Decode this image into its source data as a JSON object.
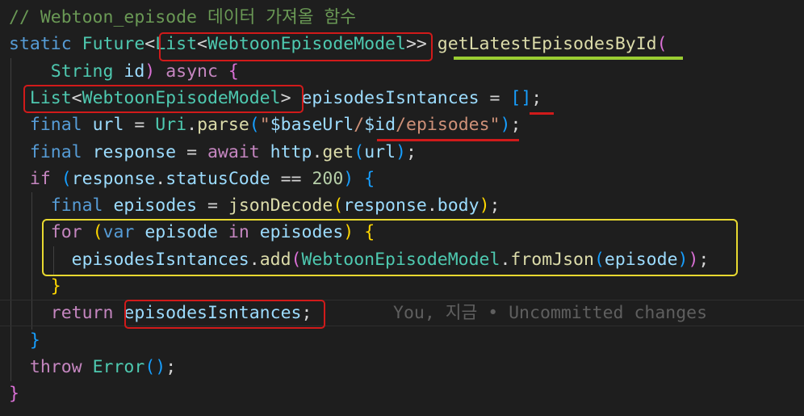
{
  "colors": {
    "background": "#1e1e1e",
    "comment": "#6a9955",
    "keyword": "#569cd6",
    "control": "#c586c0",
    "type": "#4ec9b0",
    "function": "#dcdcaa",
    "variable": "#9cdcfe",
    "string": "#ce9178",
    "number": "#b5cea8",
    "text": "#d4d4d4",
    "bracket_gold": "#ffd700",
    "bracket_purple": "#da70d6",
    "bracket_blue": "#179fff",
    "annotation_red": "#d11a1a",
    "annotation_yellow": "#e8d930",
    "annotation_green": "#9acd32"
  },
  "lines": [
    [
      {
        "t": "// Webtoon_episode 데이터 가져올 함수",
        "c": "comment"
      }
    ],
    [
      {
        "t": "static",
        "c": "keyword"
      },
      {
        "t": " "
      },
      {
        "t": "Future",
        "c": "type"
      },
      {
        "t": "<",
        "c": "text"
      },
      {
        "t": "List",
        "c": "type"
      },
      {
        "t": "<",
        "c": "text"
      },
      {
        "t": "WebtoonEpisodeModel",
        "c": "type"
      },
      {
        "t": ">>",
        "c": "text"
      },
      {
        "t": " "
      },
      {
        "t": "getLatestEpisodesById",
        "c": "function"
      },
      {
        "t": "(",
        "c": "bracket_purple"
      }
    ],
    [
      {
        "t": "    "
      },
      {
        "t": "String",
        "c": "type"
      },
      {
        "t": " "
      },
      {
        "t": "id",
        "c": "variable"
      },
      {
        "t": ")",
        "c": "bracket_purple"
      },
      {
        "t": " "
      },
      {
        "t": "async",
        "c": "control"
      },
      {
        "t": " "
      },
      {
        "t": "{",
        "c": "bracket_purple"
      }
    ],
    [
      {
        "t": "  "
      },
      {
        "t": "List",
        "c": "type"
      },
      {
        "t": "<",
        "c": "text"
      },
      {
        "t": "WebtoonEpisodeModel",
        "c": "type"
      },
      {
        "t": ">",
        "c": "text"
      },
      {
        "t": " "
      },
      {
        "t": "episodesIsntances",
        "c": "variable"
      },
      {
        "t": " = "
      },
      {
        "t": "[]",
        "c": "bracket_blue"
      },
      {
        "t": ";"
      }
    ],
    [
      {
        "t": "  "
      },
      {
        "t": "final",
        "c": "keyword"
      },
      {
        "t": " "
      },
      {
        "t": "url",
        "c": "variable"
      },
      {
        "t": " = "
      },
      {
        "t": "Uri",
        "c": "type"
      },
      {
        "t": "."
      },
      {
        "t": "parse",
        "c": "function"
      },
      {
        "t": "(",
        "c": "bracket_blue"
      },
      {
        "t": "\"",
        "c": "string"
      },
      {
        "t": "$baseUrl",
        "c": "variable"
      },
      {
        "t": "/",
        "c": "string"
      },
      {
        "t": "$id",
        "c": "variable"
      },
      {
        "t": "/episodes\"",
        "c": "string"
      },
      {
        "t": ")",
        "c": "bracket_blue"
      },
      {
        "t": ";"
      }
    ],
    [
      {
        "t": "  "
      },
      {
        "t": "final",
        "c": "keyword"
      },
      {
        "t": " "
      },
      {
        "t": "response",
        "c": "variable"
      },
      {
        "t": " = "
      },
      {
        "t": "await",
        "c": "control"
      },
      {
        "t": " "
      },
      {
        "t": "http",
        "c": "variable"
      },
      {
        "t": "."
      },
      {
        "t": "get",
        "c": "function"
      },
      {
        "t": "(",
        "c": "bracket_blue"
      },
      {
        "t": "url",
        "c": "variable"
      },
      {
        "t": ")",
        "c": "bracket_blue"
      },
      {
        "t": ";"
      }
    ],
    [
      {
        "t": "  "
      },
      {
        "t": "if",
        "c": "control"
      },
      {
        "t": " "
      },
      {
        "t": "(",
        "c": "bracket_blue"
      },
      {
        "t": "response",
        "c": "variable"
      },
      {
        "t": "."
      },
      {
        "t": "statusCode",
        "c": "variable"
      },
      {
        "t": " == "
      },
      {
        "t": "200",
        "c": "number"
      },
      {
        "t": ")",
        "c": "bracket_blue"
      },
      {
        "t": " "
      },
      {
        "t": "{",
        "c": "bracket_blue"
      }
    ],
    [
      {
        "t": "    "
      },
      {
        "t": "final",
        "c": "keyword"
      },
      {
        "t": " "
      },
      {
        "t": "episodes",
        "c": "variable"
      },
      {
        "t": " = "
      },
      {
        "t": "jsonDecode",
        "c": "function"
      },
      {
        "t": "(",
        "c": "bracket_gold"
      },
      {
        "t": "response",
        "c": "variable"
      },
      {
        "t": "."
      },
      {
        "t": "body",
        "c": "variable"
      },
      {
        "t": ")",
        "c": "bracket_gold"
      },
      {
        "t": ";"
      }
    ],
    [
      {
        "t": "    "
      },
      {
        "t": "for",
        "c": "control"
      },
      {
        "t": " "
      },
      {
        "t": "(",
        "c": "bracket_gold"
      },
      {
        "t": "var",
        "c": "keyword"
      },
      {
        "t": " "
      },
      {
        "t": "episode",
        "c": "variable"
      },
      {
        "t": " "
      },
      {
        "t": "in",
        "c": "control"
      },
      {
        "t": " "
      },
      {
        "t": "episodes",
        "c": "variable"
      },
      {
        "t": ")",
        "c": "bracket_gold"
      },
      {
        "t": " "
      },
      {
        "t": "{",
        "c": "bracket_gold"
      }
    ],
    [
      {
        "t": "      "
      },
      {
        "t": "episodesIsntances",
        "c": "variable"
      },
      {
        "t": "."
      },
      {
        "t": "add",
        "c": "function"
      },
      {
        "t": "(",
        "c": "bracket_purple"
      },
      {
        "t": "WebtoonEpisodeModel",
        "c": "type"
      },
      {
        "t": "."
      },
      {
        "t": "fromJson",
        "c": "function"
      },
      {
        "t": "(",
        "c": "bracket_blue"
      },
      {
        "t": "episode",
        "c": "variable"
      },
      {
        "t": ")",
        "c": "bracket_blue"
      },
      {
        "t": ")",
        "c": "bracket_purple"
      },
      {
        "t": ";"
      }
    ],
    [
      {
        "t": "    "
      },
      {
        "t": "}",
        "c": "bracket_gold"
      }
    ],
    [
      {
        "t": "    "
      },
      {
        "t": "return",
        "c": "control"
      },
      {
        "t": " "
      },
      {
        "t": "episodesIsntances",
        "c": "variable"
      },
      {
        "t": ";"
      }
    ],
    [
      {
        "t": "  "
      },
      {
        "t": "}",
        "c": "bracket_blue"
      }
    ],
    [
      {
        "t": "  "
      },
      {
        "t": "throw",
        "c": "control"
      },
      {
        "t": " "
      },
      {
        "t": "Error",
        "c": "type"
      },
      {
        "t": "(",
        "c": "bracket_blue"
      },
      {
        "t": ")",
        "c": "bracket_blue"
      },
      {
        "t": ";"
      }
    ],
    [
      {
        "t": "}",
        "c": "bracket_purple"
      }
    ]
  ],
  "blame": {
    "text": "You, 지금 • Uncommitted changes"
  }
}
